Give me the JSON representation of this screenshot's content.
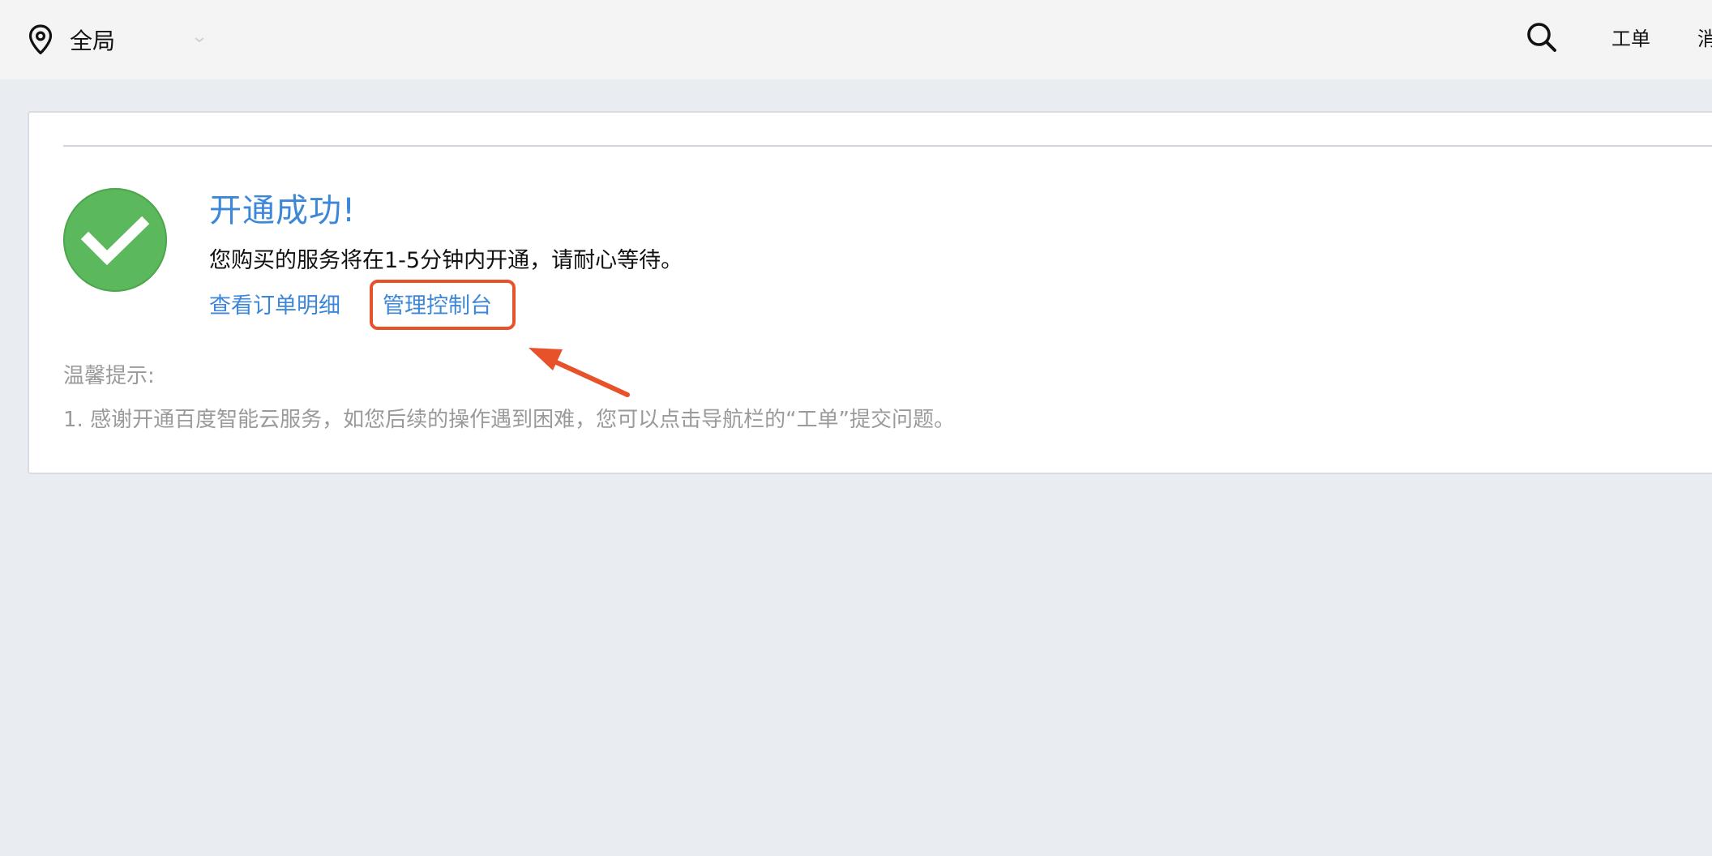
{
  "topbar": {
    "region_label": "全局",
    "nav_ticket": "工单",
    "nav_message": "消"
  },
  "result": {
    "title": "开通成功!",
    "description": "您购买的服务将在1-5分钟内开通，请耐心等待。",
    "link_order_detail": "查看订单明细",
    "link_console": "管理控制台"
  },
  "tips": {
    "title": "温馨提示:",
    "lines": [
      "1. 感谢开通百度智能云服务，如您后续的操作遇到困难，您可以点击导航栏的“工单”提交问题。"
    ]
  },
  "colors": {
    "accent": "#3d87d8",
    "success": "#5cb85c",
    "annotation": "#e8522b"
  }
}
